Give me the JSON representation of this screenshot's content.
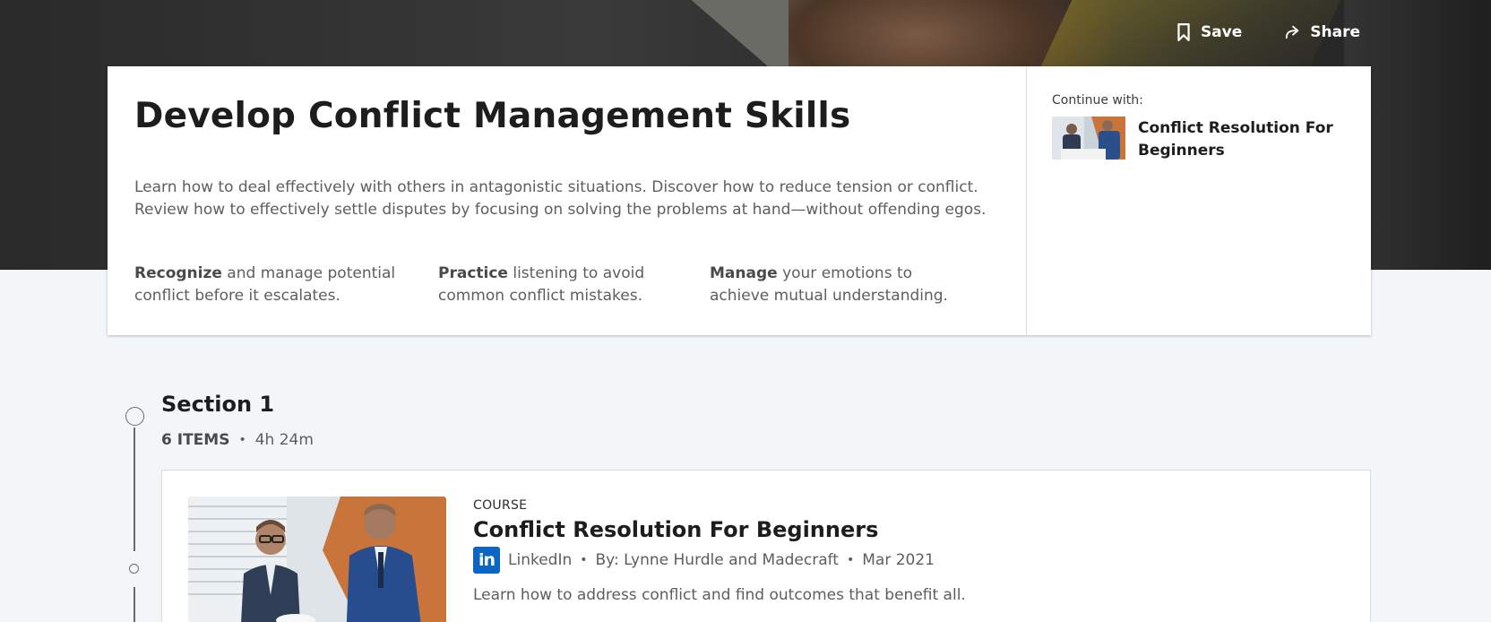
{
  "hero": {
    "save_label": "Save",
    "share_label": "Share"
  },
  "path": {
    "title": "Develop Conflict Management Skills",
    "description": "Learn how to deal effectively with others in antagonistic situations. Discover how to reduce tension or conflict. Review how to effectively settle disputes by focusing on solving the problems at hand—without offending egos.",
    "skills": [
      {
        "bold": "Recognize",
        "rest": " and manage potential conflict before it escalates."
      },
      {
        "bold": "Practice",
        "rest": " listening to avoid common conflict mistakes."
      },
      {
        "bold": "Manage",
        "rest": " your emotions to achieve mutual understanding."
      }
    ]
  },
  "continue": {
    "label": "Continue with:",
    "title": "Conflict Resolution For Beginners"
  },
  "section": {
    "title": "Section 1",
    "count": "6 ITEMS",
    "duration": "4h 24m"
  },
  "course": {
    "kind": "COURSE",
    "title": "Conflict Resolution For Beginners",
    "provider_logo": "in",
    "provider": "LinkedIn",
    "authors": "By: Lynne Hurdle and Madecraft",
    "date": "Mar 2021",
    "description": "Learn how to address conflict and find outcomes that benefit all."
  },
  "colors": {
    "linkedin_blue": "#0a66c2",
    "page_bg": "#f3f6f8"
  }
}
